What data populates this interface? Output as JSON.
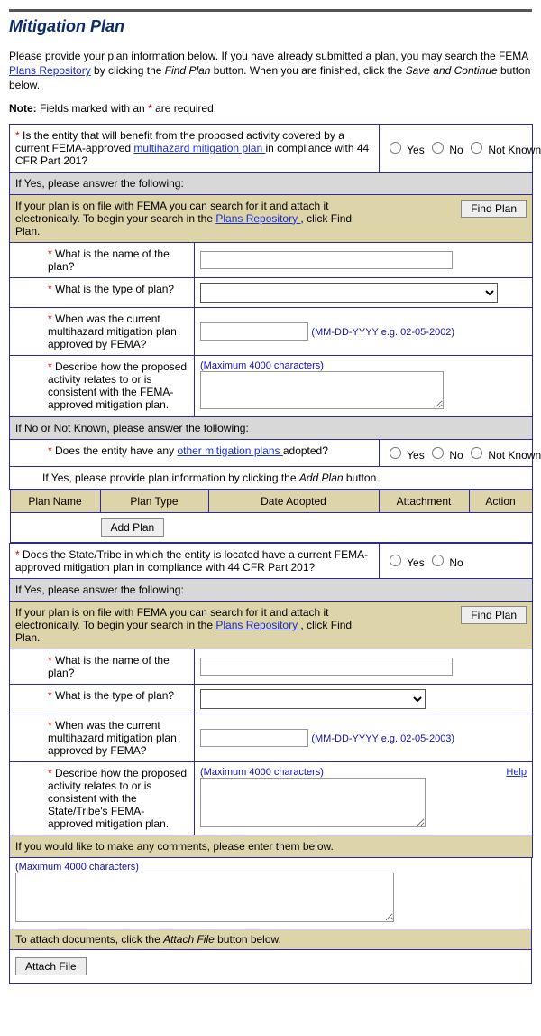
{
  "title": "Mitigation Plan",
  "intro_before_link": "Please provide your plan information below. If you have already submitted a plan, you may search the FEMA ",
  "intro_link": "Plans Repository",
  "intro_mid": " by clicking the ",
  "intro_findplan": "Find Plan",
  "intro_after": " button. When you are finished, click the ",
  "intro_savecont": "Save and Continue",
  "intro_tail": " button below.",
  "note_label": "Note:",
  "note_text": " Fields marked with an ",
  "note_tail": " are required.",
  "q1_before_link": "Is the entity that will benefit from the proposed activity covered by a current FEMA-approved ",
  "q1_link": "multihazard mitigation plan ",
  "q1_after_link": "in compliance with 44 CFR Part 201?",
  "radio_yes": "Yes",
  "radio_no": "No",
  "radio_nk": "Not Known",
  "ifyes_hdr": "If Yes, please answer the following:",
  "repo_before_link": "If your plan is on file with FEMA you can search for it and attach it electronically. To begin your search in the ",
  "repo_link": "Plans Repository ",
  "repo_after_link": ", click Find Plan.",
  "find_plan_btn": "Find Plan",
  "q_name": "What is the name of the plan?",
  "q_type": "What is the type of plan?",
  "q_when": "When was the current multihazard mitigation plan approved by FEMA?",
  "date_hint1": "(MM-DD-YYYY e.g. 02-05-2002)",
  "q_desc1": "Describe how the proposed activity relates to or is consistent with the FEMA-approved mitigation plan.",
  "max4000": "(Maximum 4000 characters)",
  "ifno_hdr": "If No or Not Known, please answer the following:",
  "q_other_before": "Does the entity have any ",
  "q_other_link": "other mitigation plans ",
  "q_other_after": "adopted?",
  "ifyes_addplan_before": "If Yes, please provide plan information by clicking the ",
  "ifyes_addplan_em": "Add Plan",
  "ifyes_addplan_after": " button.",
  "plan_cols": {
    "name": "Plan Name",
    "type": "Plan Type",
    "date": "Date Adopted",
    "attach": "Attachment",
    "action": "Action"
  },
  "add_plan_btn": "Add Plan",
  "q_state_before": "Does the State/Tribe in which the entity is located have a current FEMA-approved mitigation plan in compliance with 44 CFR Part 201?",
  "date_hint2": "(MM-DD-YYYY e.g. 02-05-2003)",
  "q_desc2": "Describe how the proposed activity relates to or is consistent with the State/Tribe's FEMA-approved mitigation plan.",
  "help_label": "Help",
  "comments_hdr": "If you would like to make any comments, please enter them below.",
  "attach_hdr_before": "To attach documents, click the ",
  "attach_hdr_em": "Attach File",
  "attach_hdr_after": " button below.",
  "attach_btn": "Attach File"
}
